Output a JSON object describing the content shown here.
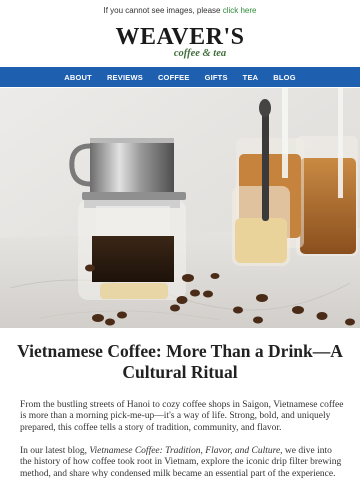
{
  "preheader": {
    "text": "If you cannot see images, please ",
    "link": "click here"
  },
  "logo": {
    "word": "WEAVER'S",
    "sub": "coffee & tea"
  },
  "nav": {
    "items": [
      "ABOUT",
      "REVIEWS",
      "COFFEE",
      "GIFTS",
      "TEA",
      "BLOG"
    ]
  },
  "colors": {
    "nav_bg": "#1f5fb0",
    "link": "#2e8b3a",
    "logo_sub": "#3f6e3b"
  },
  "article": {
    "title": "Vietnamese Coffee: More Than a Drink—A Cultural Ritual",
    "p1": "From the bustling streets of Hanoi to cozy coffee shops in Saigon, Vietnamese coffee is more than a morning pick-me-up—it's a way of life. Strong, bold, and uniquely prepared, this coffee tells a story of tradition, community, and flavor.",
    "p2_before": "In our latest blog, ",
    "p2_italic": "Vietnamese Coffee: Tradition, Flavor, and Culture",
    "p2_after": ", we dive into the history of how coffee took root in Vietnam, explore the iconic drip filter brewing method, and share why condensed milk became an essential part of the experience."
  }
}
